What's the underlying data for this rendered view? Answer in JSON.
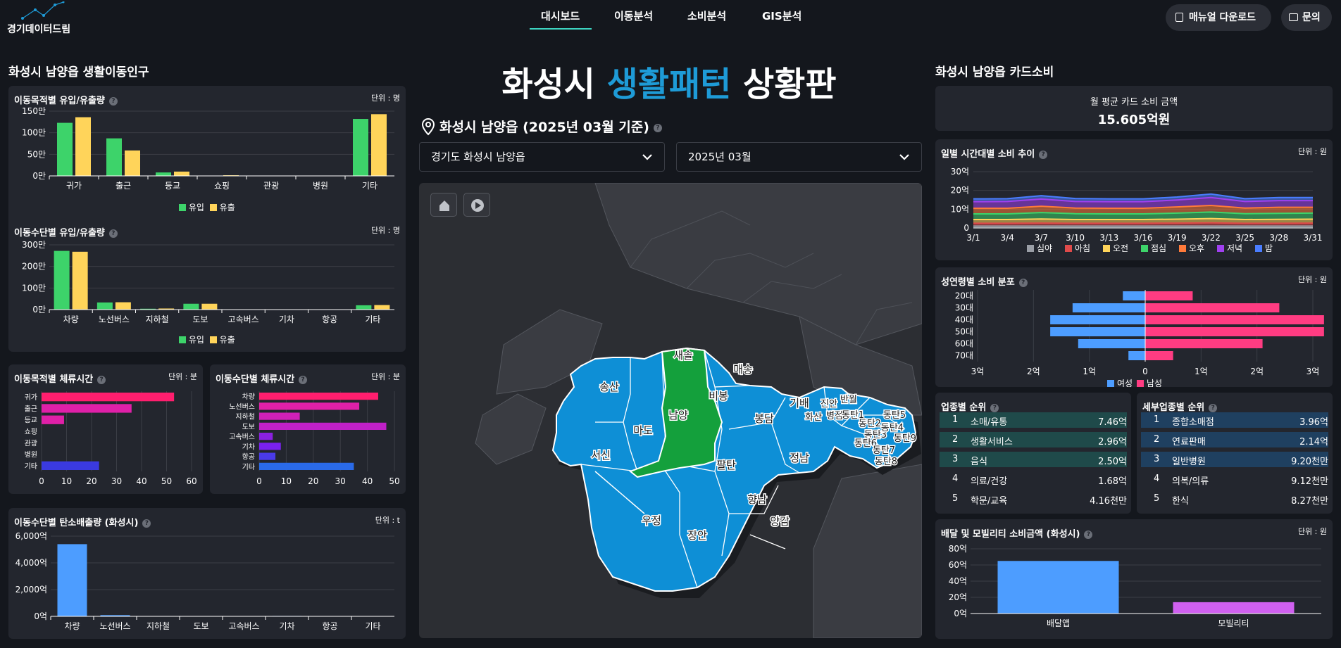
{
  "header": {
    "logo": "경기데이터드림",
    "nav": [
      "대시보드",
      "이동분석",
      "소비분석",
      "GIS분석"
    ],
    "manual": "매뉴얼 다운로드",
    "inquiry": "문의"
  },
  "left": {
    "section_title": "화성시 남양읍 생활이동인구",
    "purpose": {
      "title": "이동목적별 유입/유출량",
      "unit": "단위 : 명"
    },
    "mode": {
      "title": "이동수단별 유입/유출량",
      "unit": "단위 : 명"
    },
    "stay_purpose": {
      "title": "이동목적별 체류시간",
      "unit": "단위 : 분"
    },
    "stay_mode": {
      "title": "이동수단별 체류시간",
      "unit": "단위 : 분"
    },
    "carbon": {
      "title": "이동수단별 탄소배출량 (화성시)",
      "unit": "단위 : t"
    },
    "legend_in": "유입",
    "legend_out": "유출"
  },
  "center": {
    "title_a": "화성시 ",
    "title_b": "생활패턴",
    "title_c": " 상황판",
    "location": "화성시 남양읍 (2025년 03월 기준)",
    "region_select": "경기도 화성시 남양읍",
    "month_select": "2025년 03월",
    "map_labels": [
      "새솔",
      "매송",
      "송산",
      "비봉",
      "남양",
      "마도",
      "봉담",
      "기배",
      "진안",
      "병점",
      "반월",
      "화산",
      "동탄1",
      "동탄2",
      "동탄3",
      "동탄4",
      "동탄5",
      "동탄6",
      "동탄7",
      "동탄8",
      "동탄9",
      "서신",
      "팔탄",
      "정남",
      "향남",
      "양감",
      "우정",
      "장안"
    ]
  },
  "right": {
    "section_title": "화성시 남양읍 카드소비",
    "avg_label": "월 평균 카드 소비 금액",
    "avg_value": "15.605억원",
    "daily": {
      "title": "일별 시간대별 소비 추이",
      "unit": "단위 : 원"
    },
    "agegender": {
      "title": "성연령별 소비 분포",
      "unit": "단위 : 원",
      "legend_f": "여성",
      "legend_m": "남성"
    },
    "industry": {
      "title": "업종별 순위",
      "rows": [
        {
          "rank": "1",
          "name": "소매/유통",
          "value": "7.46억"
        },
        {
          "rank": "2",
          "name": "생활서비스",
          "value": "2.96억"
        },
        {
          "rank": "3",
          "name": "음식",
          "value": "2.50억"
        },
        {
          "rank": "4",
          "name": "의료/건강",
          "value": "1.68억"
        },
        {
          "rank": "5",
          "name": "학문/교육",
          "value": "4.16천만"
        }
      ]
    },
    "subindustry": {
      "title": "세부업종별 순위",
      "rows": [
        {
          "rank": "1",
          "name": "종합소매점",
          "value": "3.96억"
        },
        {
          "rank": "2",
          "name": "연료판매",
          "value": "2.14억"
        },
        {
          "rank": "3",
          "name": "일반병원",
          "value": "9.20천만"
        },
        {
          "rank": "4",
          "name": "의복/의류",
          "value": "9.12천만"
        },
        {
          "rank": "5",
          "name": "한식",
          "value": "8.27천만"
        }
      ]
    },
    "delivery": {
      "title": "배달 및 모빌리티 소비금액 (화성시)",
      "unit": "단위 : 원"
    }
  },
  "colors": {
    "accent": "#1e9bd7",
    "in": "#3dd36a",
    "out": "#ffd45a",
    "female": "#4d9dff",
    "male": "#ff3c82",
    "map_fill": "#0e8fd6",
    "map_sel": "#14a03c"
  },
  "chart_data": [
    {
      "type": "bar",
      "id": "purpose",
      "categories": [
        "귀가",
        "출근",
        "등교",
        "쇼핑",
        "관광",
        "병원",
        "기타"
      ],
      "series": [
        {
          "name": "유입",
          "values": [
            123,
            87,
            8,
            0.5,
            0.3,
            0.3,
            132
          ]
        },
        {
          "name": "유출",
          "values": [
            136,
            59,
            10,
            1.5,
            0.5,
            0.5,
            143
          ]
        }
      ],
      "yticks": [
        "0만",
        "50만",
        "100만",
        "150만"
      ],
      "ylim": [
        0,
        150
      ]
    },
    {
      "type": "bar",
      "id": "mode",
      "categories": [
        "차량",
        "노선버스",
        "지하철",
        "도보",
        "고속버스",
        "기차",
        "항공",
        "기타"
      ],
      "series": [
        {
          "name": "유입",
          "values": [
            272,
            33,
            4,
            27,
            0.5,
            0.5,
            0,
            20
          ]
        },
        {
          "name": "유출",
          "values": [
            268,
            34,
            5,
            27,
            0.5,
            0.5,
            0,
            21
          ]
        }
      ],
      "yticks": [
        "0만",
        "100만",
        "200만",
        "300만"
      ],
      "ylim": [
        0,
        300
      ]
    },
    {
      "type": "bar",
      "id": "stay_purpose",
      "orientation": "horizontal",
      "categories": [
        "귀가",
        "출근",
        "등교",
        "쇼핑",
        "관광",
        "병원",
        "기타"
      ],
      "values": [
        53,
        36,
        9,
        0,
        0,
        0,
        23
      ],
      "xticks": [
        "0",
        "10",
        "20",
        "30",
        "40",
        "50",
        "60"
      ],
      "xlim": [
        0,
        60
      ]
    },
    {
      "type": "bar",
      "id": "stay_mode",
      "orientation": "horizontal",
      "categories": [
        "차량",
        "노선버스",
        "지하철",
        "도보",
        "고속버스",
        "기차",
        "항공",
        "기타"
      ],
      "values": [
        44,
        37,
        15,
        47,
        5,
        8,
        6,
        35
      ],
      "xticks": [
        "0",
        "10",
        "20",
        "30",
        "40",
        "50"
      ],
      "xlim": [
        0,
        50
      ]
    },
    {
      "type": "bar",
      "id": "carbon",
      "categories": [
        "차량",
        "노선버스",
        "지하철",
        "도보",
        "고속버스",
        "기차",
        "항공",
        "기타"
      ],
      "values": [
        5400,
        90,
        20,
        0,
        5,
        30,
        0,
        0
      ],
      "yticks": [
        "0억",
        "2,000억",
        "4,000억",
        "6,000억"
      ],
      "ylim": [
        0,
        6000
      ]
    },
    {
      "type": "area",
      "id": "daily",
      "x": [
        "3/1",
        "3/4",
        "3/7",
        "3/10",
        "3/13",
        "3/16",
        "3/19",
        "3/22",
        "3/25",
        "3/28",
        "3/31"
      ],
      "yticks": [
        "0",
        "10억",
        "20억",
        "30억"
      ],
      "ylim": [
        0,
        30
      ],
      "series": [
        {
          "name": "심야",
          "values": [
            1,
            1,
            1,
            1,
            1,
            1,
            1,
            1,
            1,
            1,
            1
          ]
        },
        {
          "name": "아침",
          "values": [
            1.5,
            1.5,
            1.6,
            1.5,
            1.5,
            1.5,
            1.6,
            1.7,
            1.5,
            1.5,
            1.6
          ]
        },
        {
          "name": "오전",
          "values": [
            2,
            2,
            2.2,
            2,
            2,
            2,
            2.1,
            2.3,
            2,
            2.1,
            2.1
          ]
        },
        {
          "name": "점심",
          "values": [
            3,
            3,
            3.4,
            3.1,
            3,
            3,
            3.2,
            3.5,
            3.1,
            3.2,
            3.2
          ]
        },
        {
          "name": "오후",
          "values": [
            3,
            3,
            3.4,
            3,
            3,
            3,
            3.3,
            3.5,
            3,
            3.2,
            3.1
          ]
        },
        {
          "name": "저녁",
          "values": [
            3.5,
            3.6,
            3.8,
            3.5,
            3.5,
            3.5,
            3.7,
            4.2,
            3.5,
            3.6,
            3.6
          ]
        },
        {
          "name": "밤",
          "values": [
            1.5,
            1.5,
            1.8,
            1.6,
            1.5,
            1.5,
            1.6,
            1.9,
            1.5,
            1.6,
            1.6
          ]
        }
      ]
    },
    {
      "type": "bar",
      "id": "agegender",
      "orientation": "horizontal",
      "categories": [
        "20대",
        "30대",
        "40대",
        "50대",
        "60대",
        "70대"
      ],
      "series": [
        {
          "name": "여성",
          "values": [
            0.4,
            1.3,
            1.7,
            1.7,
            1.2,
            0.3
          ]
        },
        {
          "name": "남성",
          "values": [
            0.85,
            2.4,
            3.2,
            3.2,
            2.1,
            0.5
          ]
        }
      ],
      "xticks": [
        "3억",
        "2억",
        "1억",
        "0",
        "1억",
        "2억",
        "3억"
      ],
      "xlim": [
        -3,
        3
      ]
    },
    {
      "type": "bar",
      "id": "delivery",
      "categories": [
        "배달앱",
        "모빌리티"
      ],
      "values": [
        65,
        14
      ],
      "yticks": [
        "0억",
        "20억",
        "40억",
        "60억",
        "80억"
      ],
      "ylim": [
        0,
        80
      ]
    }
  ]
}
